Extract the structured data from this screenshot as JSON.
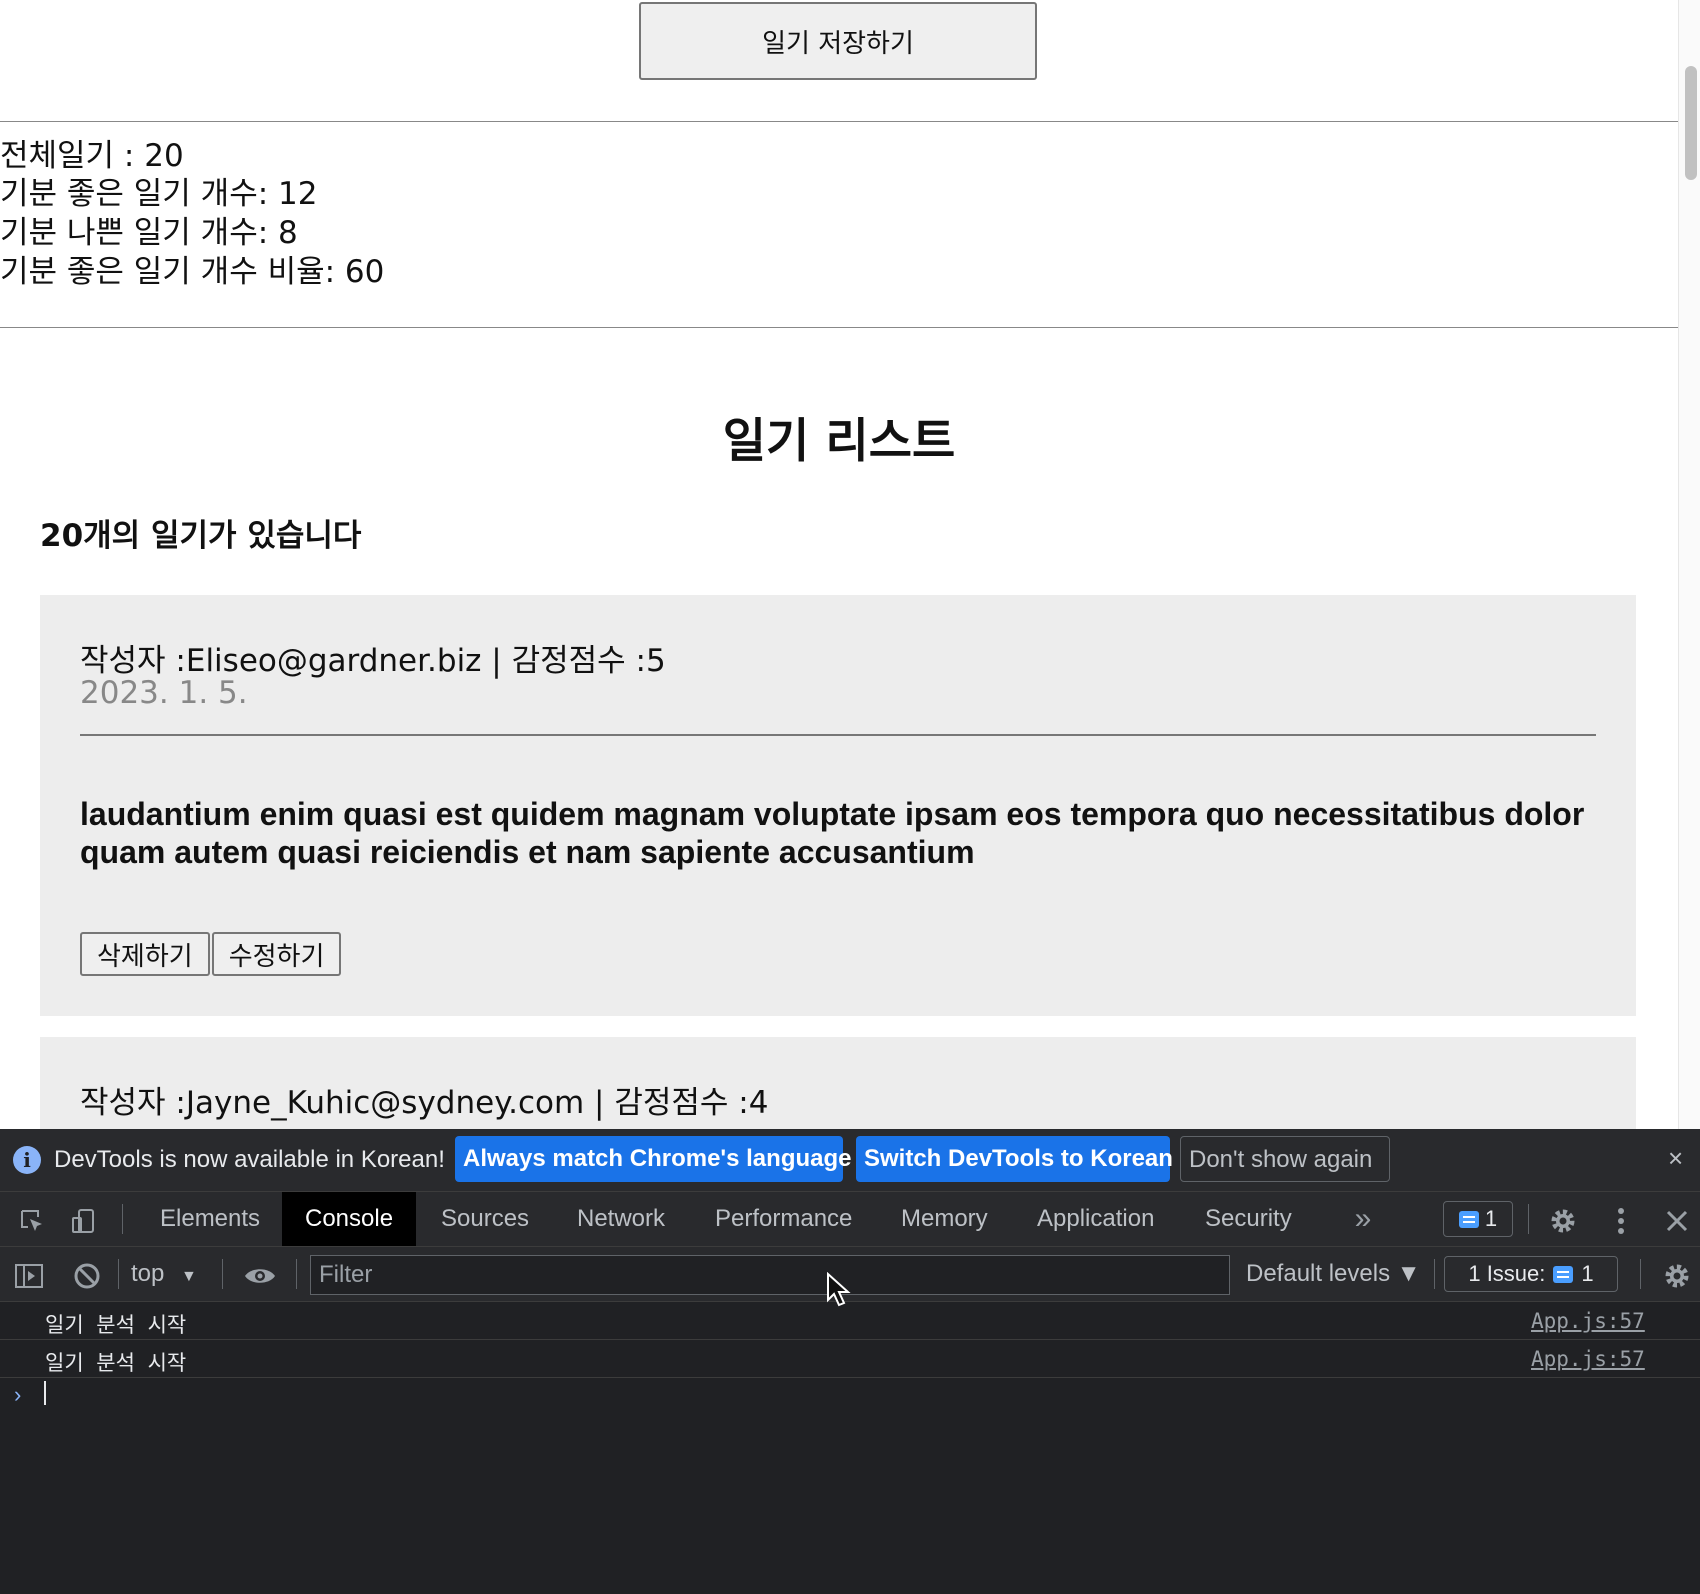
{
  "page": {
    "save_button": "일기 저장하기",
    "stats": {
      "total": "전체일기 : 20",
      "good": "기분 좋은 일기 개수: 12",
      "bad": "기분 나쁜 일기 개수: 8",
      "ratio": "기분 좋은 일기 개수 비율: 60"
    },
    "list_title": "일기 리스트",
    "list_count": "20개의 일기가 있습니다",
    "diaries": [
      {
        "meta": "작성자 :Eliseo@gardner.biz | 감정점수 :5",
        "date": "2023. 1. 5.",
        "content": "laudantium enim quasi est quidem magnam voluptate ipsam eos tempora quo necessitatibus dolor quam autem quasi reiciendis et nam sapiente accusantium",
        "delete_label": "삭제하기",
        "edit_label": "수정하기"
      },
      {
        "meta": "작성자 :Jayne_Kuhic@sydney.com | 감정점수 :4"
      }
    ]
  },
  "devtools": {
    "infobar": {
      "message": "DevTools is now available in Korean!",
      "match_button": "Always match Chrome's language",
      "switch_button": "Switch DevTools to Korean",
      "dont_show_button": "Don't show again",
      "close": "×"
    },
    "tabs": [
      "Elements",
      "Console",
      "Sources",
      "Network",
      "Performance",
      "Memory",
      "Application",
      "Security"
    ],
    "active_tab": "Console",
    "more_tabs": "»",
    "message_count": "1",
    "toolbar": {
      "context": "top",
      "filter_placeholder": "Filter",
      "levels": "Default levels ▼",
      "issues_label": "1 Issue:",
      "issues_count": "1"
    },
    "logs": [
      {
        "message": "일기 분석 시작",
        "source": "App.js:57"
      },
      {
        "message": "일기 분석 시작",
        "source": "App.js:57"
      }
    ],
    "prompt": "›"
  },
  "icons": {
    "info": "info-icon",
    "inspect": "inspect-element-icon",
    "device": "device-toolbar-icon",
    "settings": "gear-icon",
    "kebab": "kebab-menu-icon",
    "close": "close-icon",
    "sidebar": "sidebar-toggle-icon",
    "clear": "clear-console-icon",
    "eye": "eye-icon",
    "messages": "chat-icon"
  },
  "colors": {
    "accent": "#1a73e8",
    "devtools_bg": "#202124",
    "card_bg": "#ededed"
  }
}
